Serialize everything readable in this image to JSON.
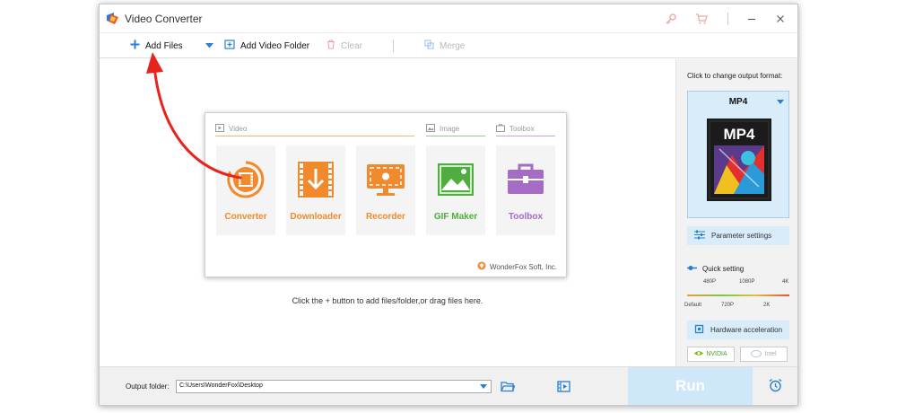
{
  "window": {
    "title": "Video Converter"
  },
  "toolbar": {
    "add_files": "Add Files",
    "add_video_folder": "Add Video Folder",
    "clear": "Clear",
    "merge": "Merge"
  },
  "main": {
    "sections": {
      "video": "Video",
      "image": "Image",
      "toolbox": "Toolbox"
    },
    "tiles": [
      {
        "label": "Converter",
        "icon": "film-reel-icon",
        "color": "#f08a2c"
      },
      {
        "label": "Downloader",
        "icon": "download-film-icon",
        "color": "#f08a2c"
      },
      {
        "label": "Recorder",
        "icon": "screen-record-icon",
        "color": "#f08a2c"
      },
      {
        "label": "GIF Maker",
        "icon": "image-mountain-icon",
        "color": "#4fae3f"
      },
      {
        "label": "Toolbox",
        "icon": "toolbox-icon",
        "color": "#a46cc4"
      }
    ],
    "brand": "WonderFox Soft, Inc.",
    "hint": "Click the + button to add files/folder,or drag files here."
  },
  "side_panel": {
    "output_label": "Click to change output format:",
    "format": "MP4",
    "format_badge": "MP4",
    "parameter_settings": "Parameter settings",
    "quick_setting": "Quick setting",
    "quality_top": [
      "480P",
      "1080P",
      "4K"
    ],
    "quality_bottom": [
      "Default",
      "720P",
      "2K"
    ],
    "hardware_acceleration": "Hardware acceleration",
    "gpu": {
      "nvidia": "NVIDIA",
      "intel": "Intel"
    }
  },
  "bottom": {
    "output_folder_label": "Output folder:",
    "output_path": "C:\\Users\\WonderFox\\Desktop",
    "run": "Run"
  },
  "colors": {
    "accent": "#2a7fd0",
    "orange": "#f08a2c",
    "green": "#4fae3f",
    "purple": "#a46cc4",
    "arrow": "#e8231c"
  }
}
